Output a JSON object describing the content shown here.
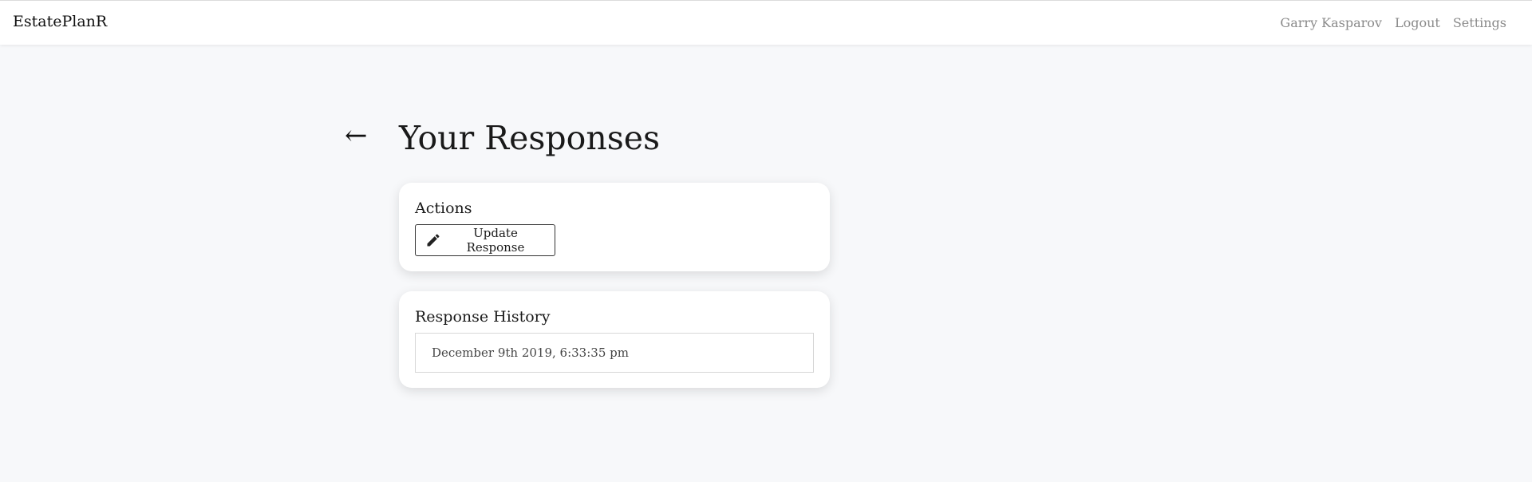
{
  "app": {
    "brand": "EstatePlanR"
  },
  "nav": {
    "user_name": "Garry Kasparov",
    "logout_label": "Logout",
    "settings_label": "Settings"
  },
  "page": {
    "back_glyph": "←",
    "title": "Your Responses"
  },
  "actions_card": {
    "title": "Actions",
    "update_button_label": "Update Response",
    "update_button_icon": "pencil-icon"
  },
  "history_card": {
    "title": "Response History",
    "items": [
      {
        "timestamp": "December 9th 2019, 6:33:35 pm"
      }
    ]
  }
}
